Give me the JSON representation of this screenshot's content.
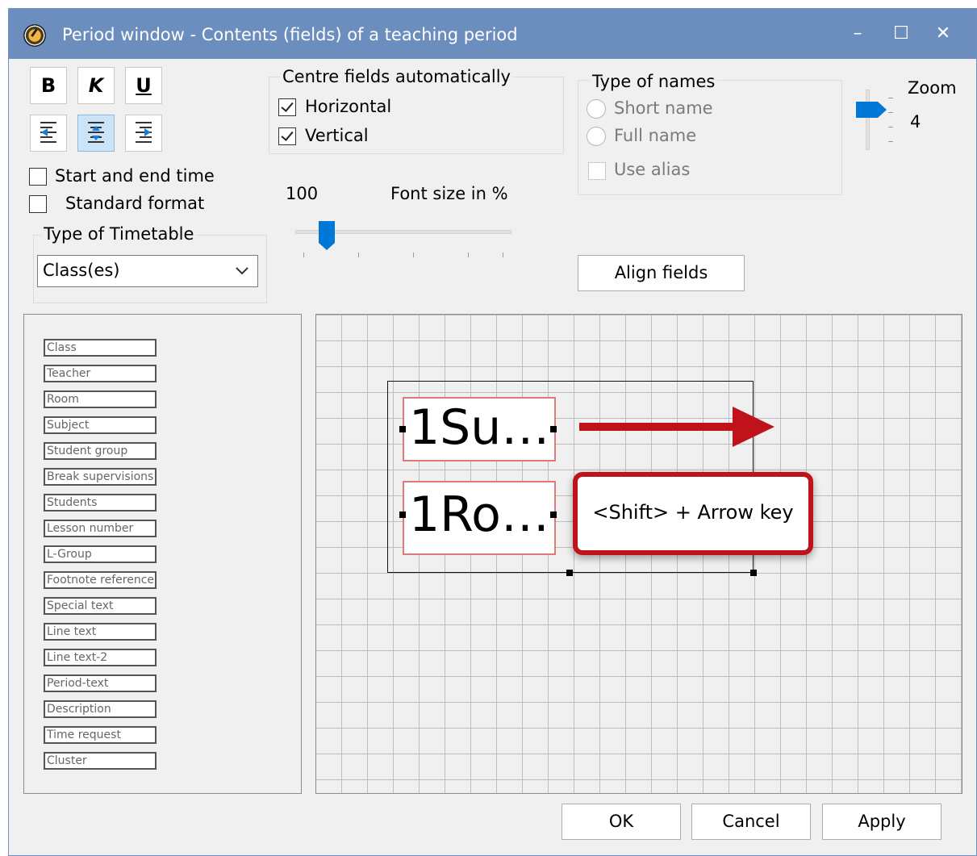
{
  "window": {
    "title": "Period window - Contents (fields) of a teaching period",
    "controls": {
      "minimize": "–",
      "maximize": "☐",
      "close": "✕"
    }
  },
  "toolbar": {
    "bold": "B",
    "italic": "K",
    "underline": "U"
  },
  "options": {
    "start_end_time": "Start and end time",
    "standard_format": "Standard format",
    "start_end_time_checked": false,
    "standard_format_checked": false
  },
  "timetable_type": {
    "label": "Type of Timetable",
    "selected": "Class(es)"
  },
  "centre_fields": {
    "label": "Centre fields automatically",
    "horizontal": "Horizontal",
    "vertical": "Vertical",
    "horizontal_checked": true,
    "vertical_checked": true
  },
  "font_size": {
    "value": "100",
    "label": "Font size in %",
    "slider_fraction": 0.14
  },
  "names": {
    "label": "Type of names",
    "short": "Short name",
    "full": "Full name",
    "alias": "Use alias"
  },
  "zoom": {
    "label": "Zoom",
    "value": "4"
  },
  "align_fields": "Align fields",
  "field_list": [
    "Class",
    "Teacher",
    "Room",
    "Subject",
    "Student group",
    "Break supervisions",
    "Students",
    "Lesson number",
    "L-Group",
    "Footnote reference",
    "Special text",
    "Line text",
    "Line text-2",
    "Period-text",
    "Description",
    "Time request",
    "Cluster"
  ],
  "preview": {
    "field1": "1Su…",
    "field2": "1Ro…",
    "callout": "<Shift> + Arrow key"
  },
  "buttons": {
    "ok": "OK",
    "cancel": "Cancel",
    "apply": "Apply"
  },
  "colors": {
    "titlebar": "#6c8ebf",
    "accent_blue": "#0078d7",
    "callout_red": "#c0121b"
  }
}
